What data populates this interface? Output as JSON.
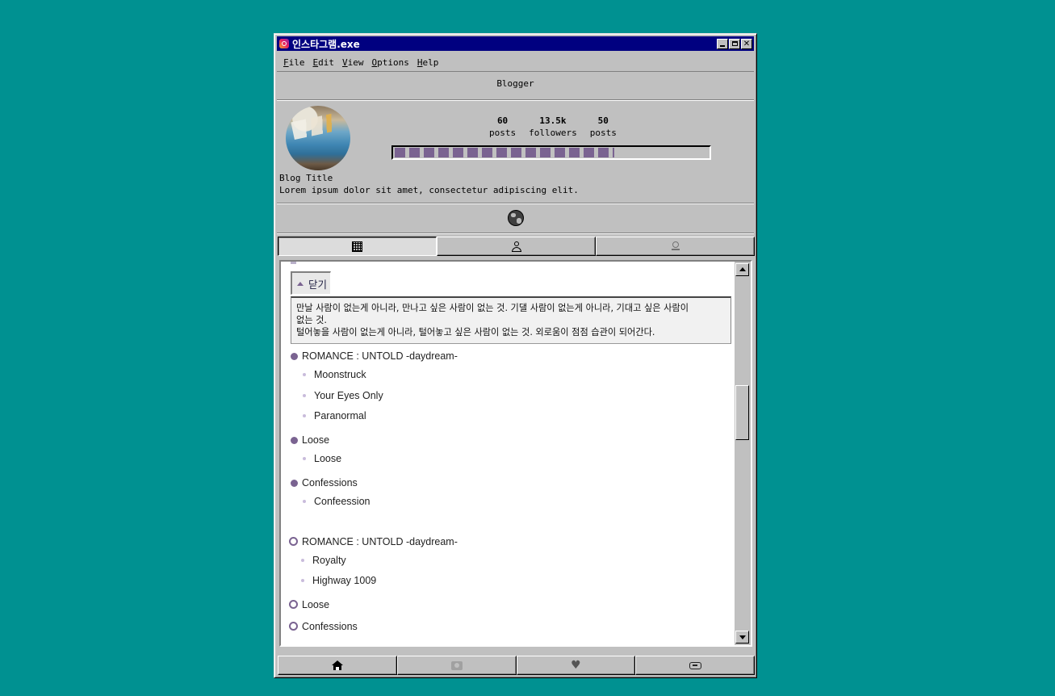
{
  "window": {
    "title": "인스타그램.exe"
  },
  "menu": [
    {
      "key": "F",
      "rest": "ile"
    },
    {
      "key": "E",
      "rest": "dit"
    },
    {
      "key": "V",
      "rest": "iew"
    },
    {
      "key": "O",
      "rest": "ptions"
    },
    {
      "key": "H",
      "rest": "elp"
    }
  ],
  "profile": {
    "username": "Blogger",
    "stats": [
      {
        "value": "60",
        "label": "posts"
      },
      {
        "value": "13.5k",
        "label": "followers"
      },
      {
        "value": "50",
        "label": "posts"
      }
    ],
    "progress_fraction": 0.7,
    "blog_title": "Blog Title",
    "blog_description": "Lorem ipsum dolor sit amet, consectetur adipiscing elit."
  },
  "icons": {
    "globe": "globe-icon",
    "tabs": [
      "grid-icon",
      "person-icon",
      "location-pin-icon"
    ],
    "bottom": [
      "home-icon",
      "camera-icon",
      "heart-icon",
      "gamepad-icon"
    ]
  },
  "colors": {
    "accent": "#7a6391",
    "desktop": "#009191",
    "titlebar": "#000080"
  },
  "content": {
    "close_label": "닫기",
    "quote_lines": [
      "만날 사람이 없는게 아니라, 만나고 싶은 사람이 없는 것. 기댈 사람이 없는게 아니라, 기대고 싶은 사람이",
      "없는 것.",
      "털어놓을 사람이 없는게 아니라, 털어놓고 싶은 사람이 없는 것. 외로움이 점점 습관이 되어간다."
    ],
    "groups": [
      {
        "title": "ROMANCE : UNTOLD -daydream-",
        "items": [
          "Moonstruck",
          "Your Eyes Only",
          "Paranormal"
        ]
      },
      {
        "title": "Loose",
        "items": [
          "Loose"
        ]
      },
      {
        "title": "Confessions",
        "items": [
          "Confeession"
        ]
      },
      {
        "title": "ROMANCE : UNTOLD -daydream-",
        "items": [
          "Royalty",
          "Highway 1009"
        ]
      },
      {
        "title": "Loose",
        "items": []
      },
      {
        "title": "Confessions",
        "items": []
      }
    ]
  }
}
